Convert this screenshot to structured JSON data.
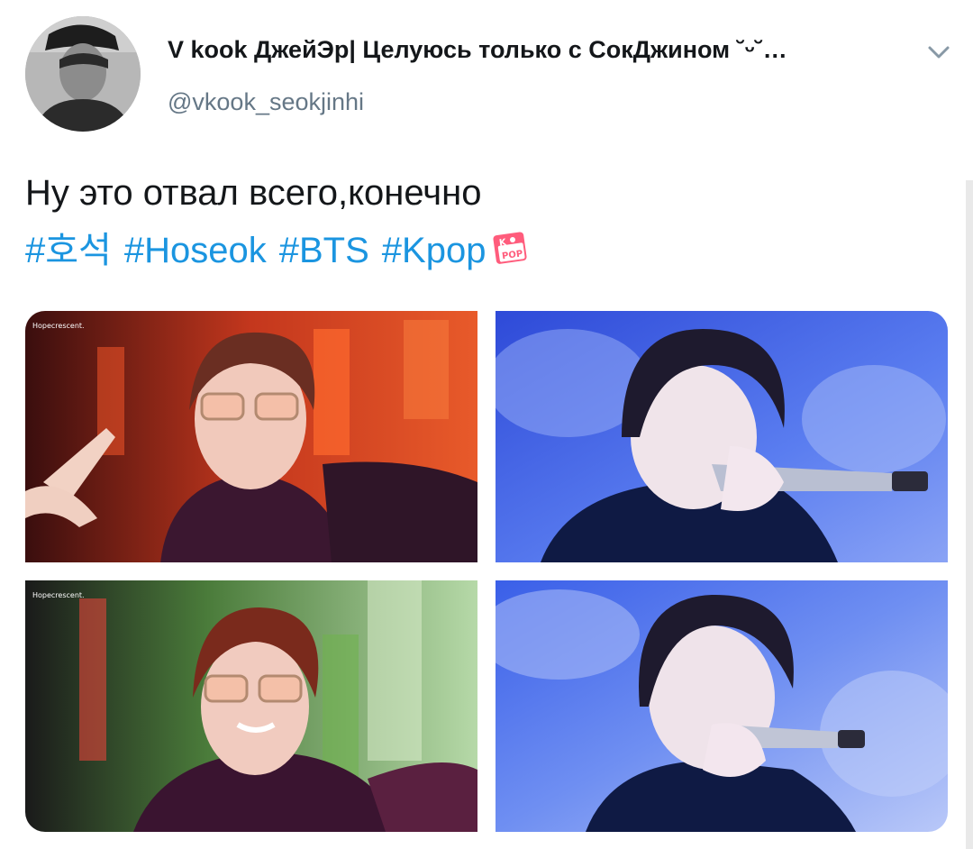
{
  "author": {
    "display_name": "V kook ДжейЭр| Целуюсь только с СокДжином ˘ᵕ˘…",
    "handle": "@vkook_seokjinhi"
  },
  "tweet": {
    "text": "Ну это отвал всего,конечно",
    "hashtags": [
      "#호석",
      "#Hoseok",
      "#BTS",
      "#Kpop"
    ],
    "emoji": "kpop-sticker-icon"
  },
  "media": {
    "watermark_1": "Hopecrescent.",
    "watermark_3": "Hopecrescent."
  },
  "colors": {
    "link": "#1b95e0",
    "text": "#14171a",
    "secondary": "#657786"
  }
}
